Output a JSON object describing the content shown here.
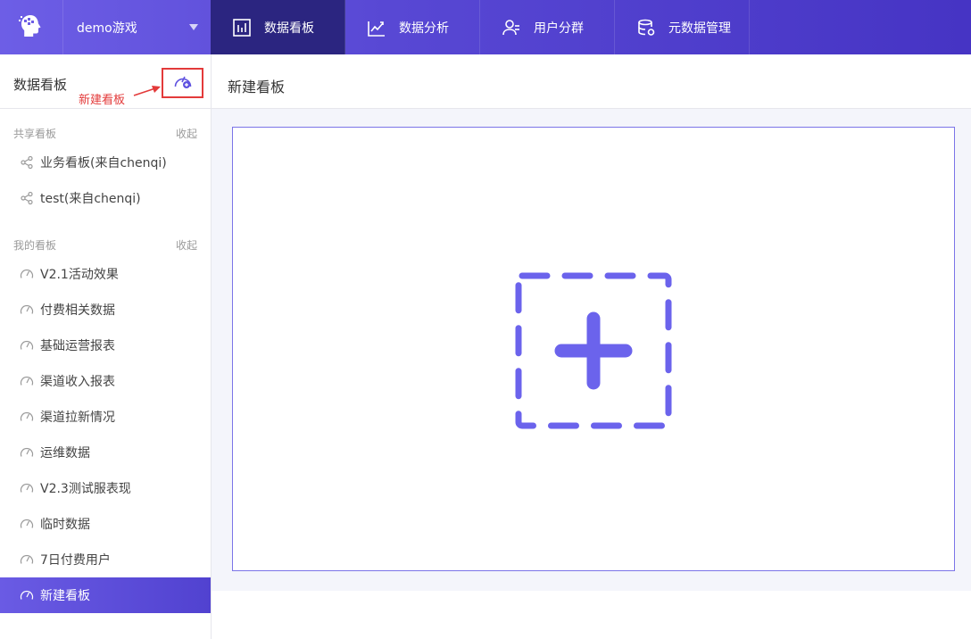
{
  "colors": {
    "accent": "#5f52e0",
    "nav_active": "#2b2580",
    "annotation": "#e33a3a",
    "placeholder": "#6b63ec"
  },
  "topbar": {
    "logo_icon": "head-logo-icon",
    "game": "demo游戏",
    "nav": [
      {
        "label": "数据看板",
        "icon": "bar-chart-icon",
        "active": true
      },
      {
        "label": "数据分析",
        "icon": "trend-chart-icon",
        "active": false
      },
      {
        "label": "用户分群",
        "icon": "users-icon",
        "active": false
      },
      {
        "label": "元数据管理",
        "icon": "database-icon",
        "active": false
      }
    ]
  },
  "sidebar": {
    "title": "数据看板",
    "new_board_annotation": "新建看板",
    "shared": {
      "label": "共享看板",
      "collapse": "收起",
      "items": [
        "业务看板(来自chenqi)",
        "test(来自chenqi)"
      ]
    },
    "mine": {
      "label": "我的看板",
      "collapse": "收起",
      "items": [
        "V2.1活动效果",
        "付费相关数据",
        "基础运营报表",
        "渠道收入报表",
        "渠道拉新情况",
        "运维数据",
        "V2.3测试服表现",
        "临时数据",
        "7日付费用户",
        "新建看板"
      ],
      "active_index": 9
    }
  },
  "main": {
    "title": "新建看板",
    "add_icon": "add-widget-icon"
  }
}
